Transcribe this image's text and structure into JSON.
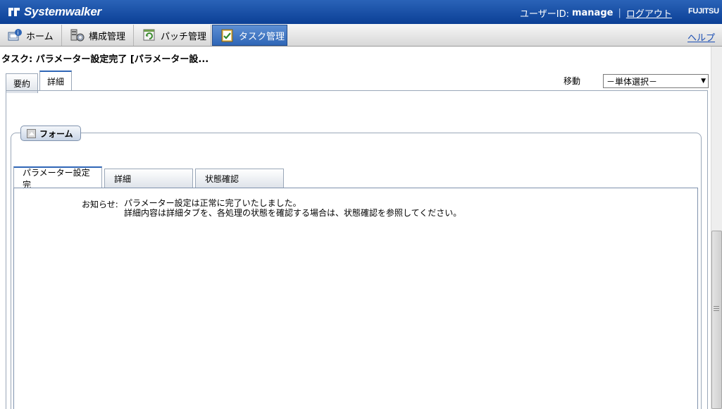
{
  "header": {
    "brand": "Systemwalker",
    "user_label": "ユーザーID:",
    "user_name": "manage",
    "separator": "|",
    "logout": "ログアウト",
    "vendor": "FUJITSU"
  },
  "nav": {
    "items": [
      {
        "label": "ホーム",
        "icon": "home-icon"
      },
      {
        "label": "構成管理",
        "icon": "configuration-icon"
      },
      {
        "label": "パッチ管理",
        "icon": "patch-icon"
      },
      {
        "label": "タスク管理",
        "icon": "task-icon"
      }
    ],
    "active_index": 3,
    "help": "ヘルプ"
  },
  "page": {
    "title": "タスク: パラメーター設定完了 [パラメーター設..."
  },
  "main_tabs": {
    "items": [
      {
        "label": "要約"
      },
      {
        "label": "詳細"
      }
    ],
    "active_index": 1
  },
  "move": {
    "label": "移動",
    "select_value": "－単体選択－"
  },
  "form": {
    "legend": "フォーム",
    "subtabs": [
      {
        "label": "パラメーター設定完"
      },
      {
        "label": "詳細"
      },
      {
        "label": "状態確認"
      }
    ],
    "active_subtab": 0,
    "notice_label": "お知らせ:",
    "notice_line1": "パラメーター設定は正常に完了いたしました。",
    "notice_line2": "詳細内容は詳細タブを、各処理の状態を確認する場合は、状態確認を参照してください。"
  },
  "colors": {
    "header_blue": "#0b3f95",
    "active_tab_blue": "#2f66b6",
    "link_blue": "#1c4fb4"
  }
}
